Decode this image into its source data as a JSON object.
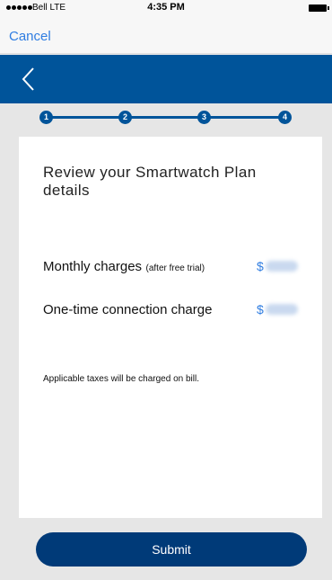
{
  "status_bar": {
    "carrier": "Bell  LTE",
    "time": "4:35 PM"
  },
  "browser": {
    "cancel_label": "Cancel"
  },
  "navbar": {
    "back_icon": "chevron-left-icon"
  },
  "stepper": {
    "steps": [
      "1",
      "2",
      "3",
      "4"
    ]
  },
  "plan": {
    "title": "Review your Smartwatch Plan details",
    "monthly_label": "Monthly charges",
    "monthly_note": "(after free trial)",
    "monthly_currency": "$",
    "connection_label": "One-time connection charge",
    "connection_currency": "$",
    "taxes_note": "Applicable taxes will be charged on bill."
  },
  "actions": {
    "submit_label": "Submit"
  },
  "colors": {
    "brand_blue": "#00549a",
    "button_blue": "#003a78",
    "link_blue": "#2f7de1"
  }
}
